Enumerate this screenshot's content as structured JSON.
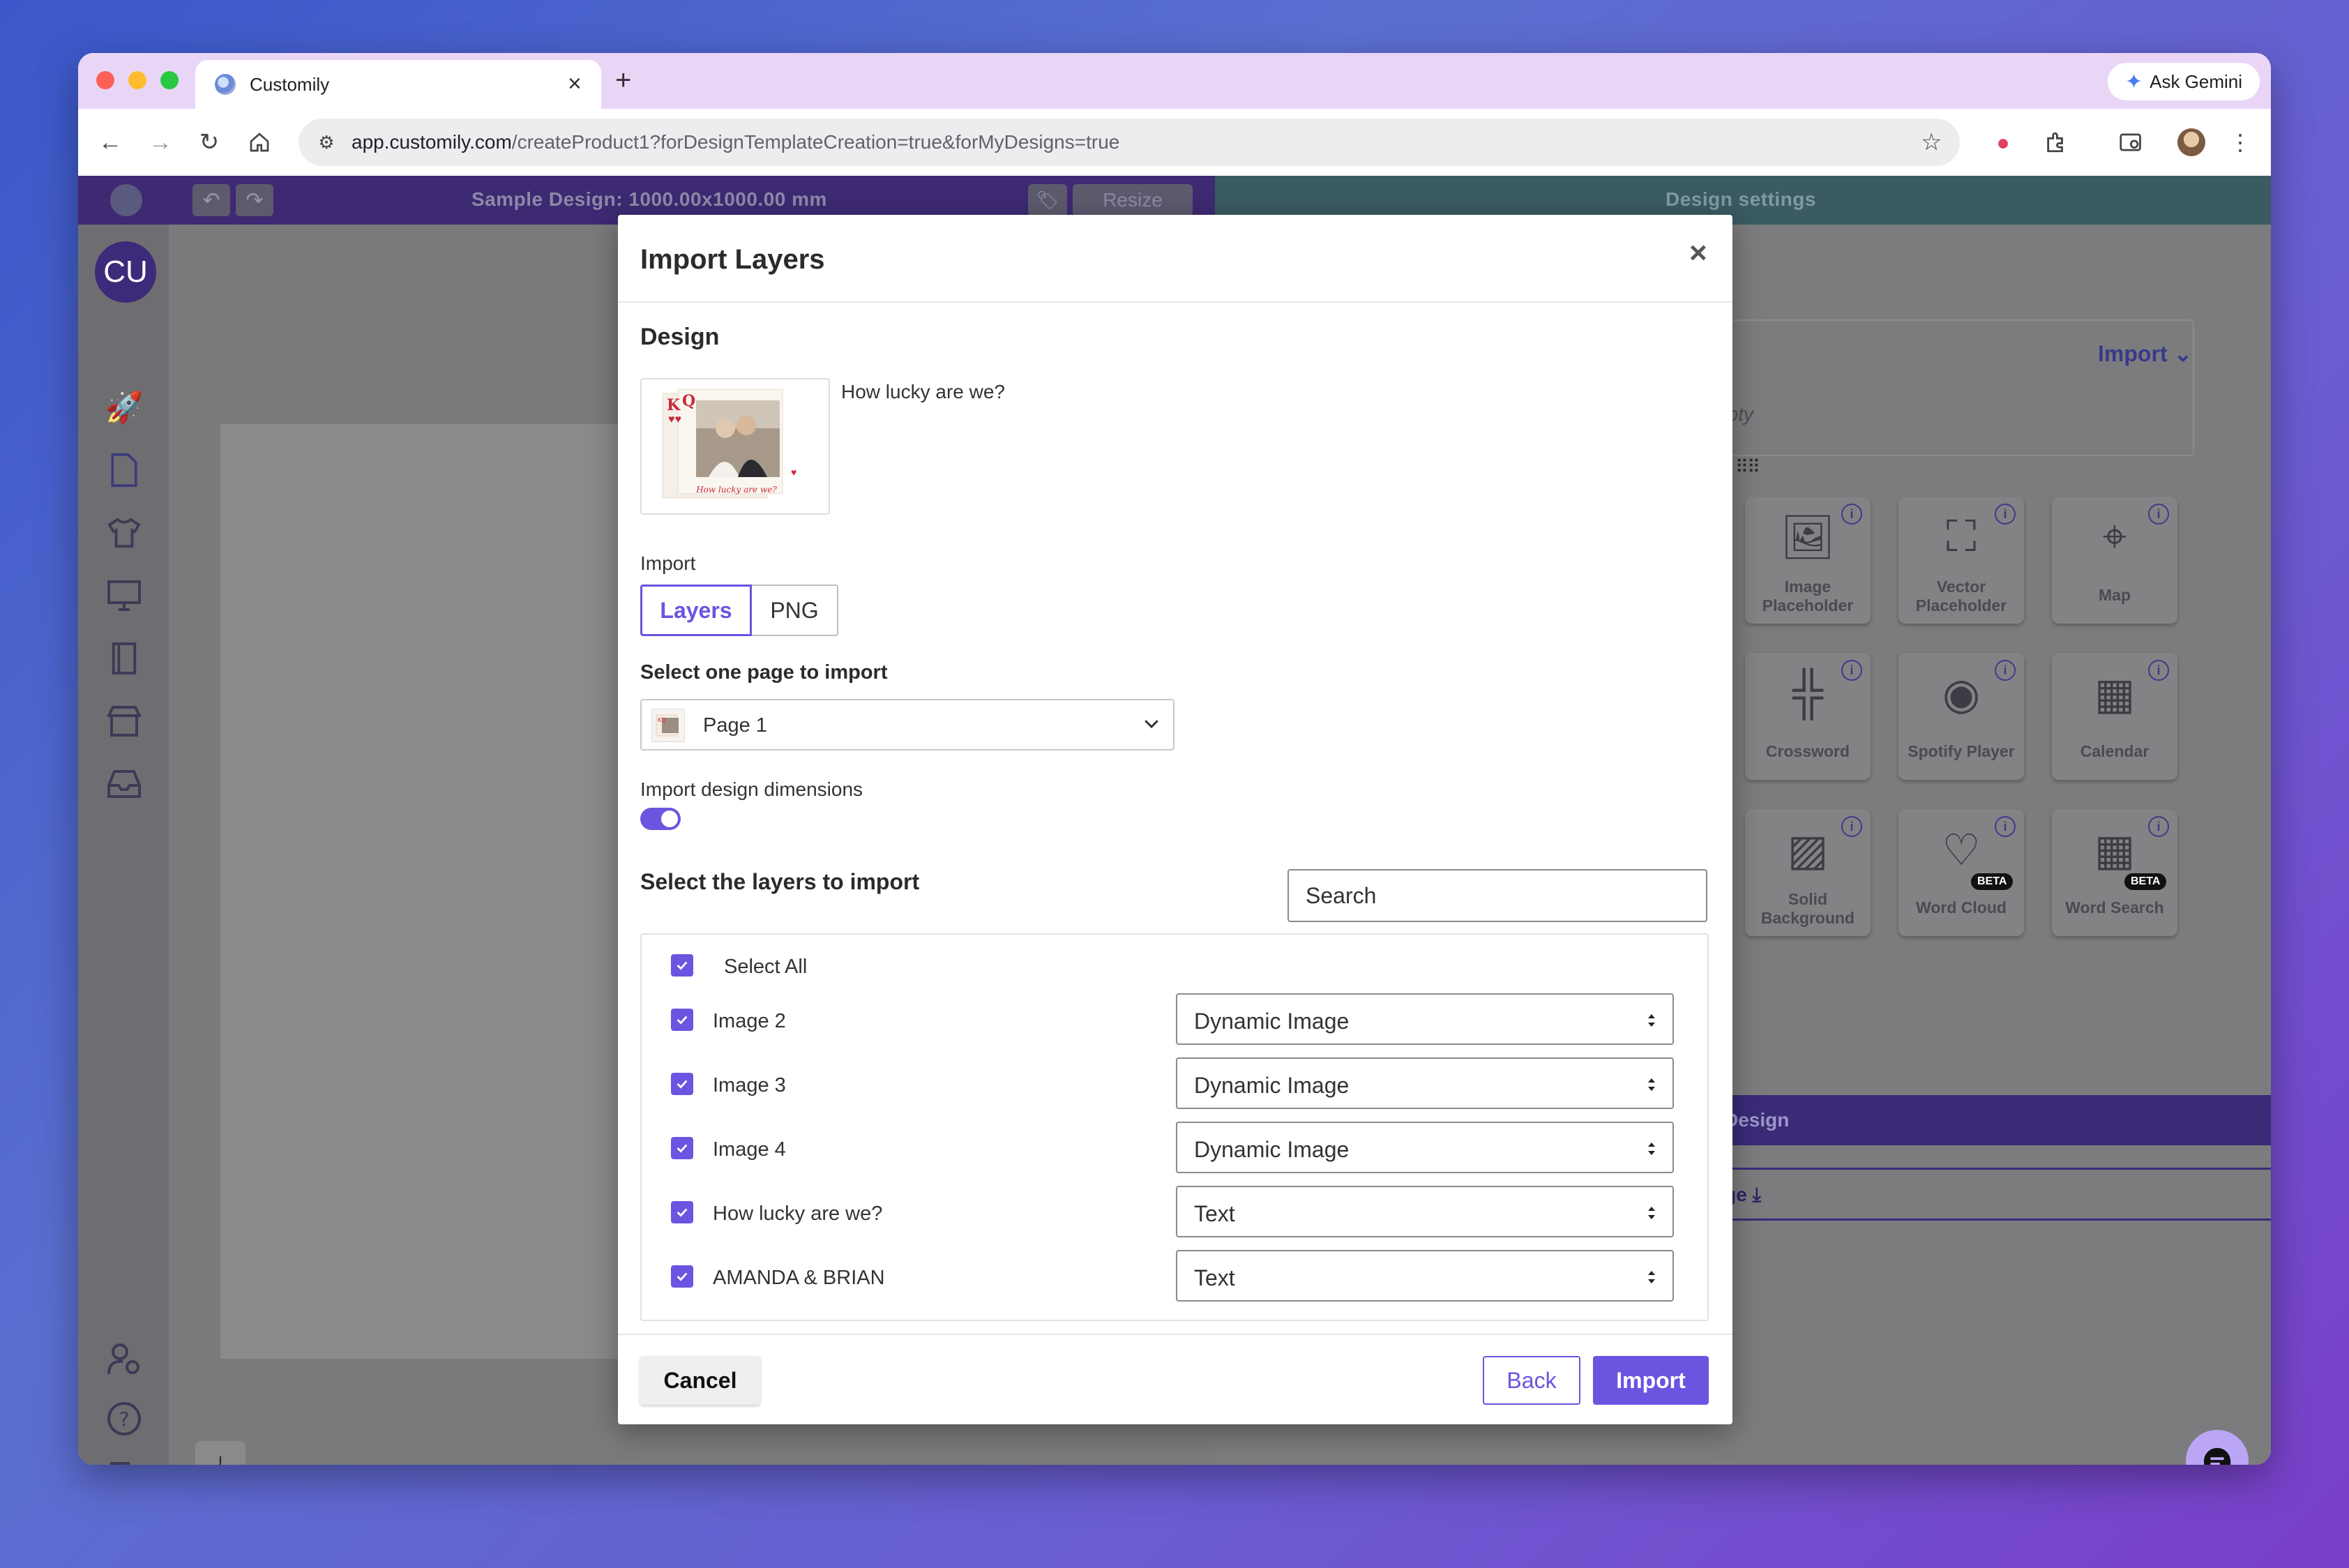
{
  "browser": {
    "tab_title": "Customily",
    "new_tab_label": "+",
    "gemini_label": "Ask Gemini",
    "url_host": "app.customily.com",
    "url_path": "/createProduct1?forDesignTemplateCreation=true&forMyDesigns=true"
  },
  "app": {
    "avatar_initials": "CU",
    "design_title": "Sample Design: 1000.00x1000.00 mm",
    "resize_label": "Resize",
    "settings_title": "Design settings",
    "import_dropdown_label": "Import",
    "empty_text": "s empty",
    "tools": [
      {
        "label": "Image Placeholder",
        "icon": "image-placeholder-icon"
      },
      {
        "label": "Vector Placeholder",
        "icon": "vector-placeholder-icon"
      },
      {
        "label": "Map",
        "icon": "map-pin-icon"
      },
      {
        "label": "Crossword",
        "icon": "crossword-icon"
      },
      {
        "label": "Spotify Player",
        "icon": "spotify-icon"
      },
      {
        "label": "Calendar",
        "icon": "calendar-icon"
      },
      {
        "label": "Solid Background",
        "icon": "solid-background-icon"
      },
      {
        "label": "Word Cloud",
        "icon": "word-cloud-icon",
        "badge": "BETA"
      },
      {
        "label": "Word Search",
        "icon": "word-search-icon",
        "badge": "BETA"
      }
    ],
    "design_button_label": "Design",
    "upload_button_label": "d Image"
  },
  "modal": {
    "title": "Import Layers",
    "close_label": "×",
    "design_section": "Design",
    "design_name": "How lucky are we?",
    "thumb_caption": "How lucky are we?",
    "import_label": "Import",
    "import_options": [
      "Layers",
      "PNG"
    ],
    "import_selected": "Layers",
    "select_page_label": "Select one page to import",
    "page_selected": "Page 1",
    "dimensions_label": "Import design dimensions",
    "dimensions_enabled": true,
    "select_layers_label": "Select the layers to import",
    "search_placeholder": "Search",
    "select_all_label": "Select All",
    "layers": [
      {
        "name": "Image 2",
        "type": "Dynamic Image",
        "checked": true
      },
      {
        "name": "Image 3",
        "type": "Dynamic Image",
        "checked": true
      },
      {
        "name": "Image 4",
        "type": "Dynamic Image",
        "checked": true
      },
      {
        "name": "How lucky are we?",
        "type": "Text",
        "checked": true
      },
      {
        "name": "AMANDA & BRIAN",
        "type": "Text",
        "checked": true
      }
    ],
    "cancel_label": "Cancel",
    "back_label": "Back",
    "import_button_label": "Import"
  },
  "colors": {
    "accent": "#6a55e0",
    "tab_bar": "#e9d6f7"
  }
}
